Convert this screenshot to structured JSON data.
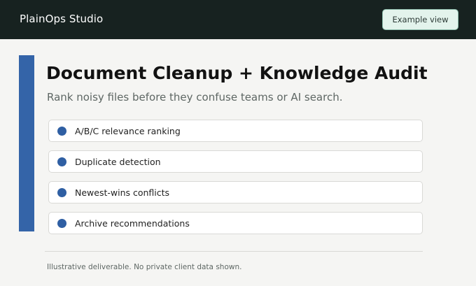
{
  "header": {
    "brand": "PlainOps Studio",
    "example_button_label": "Example view"
  },
  "main": {
    "title": "Document Cleanup + Knowledge Audit",
    "subtitle": "Rank noisy files before they confuse teams or AI search.",
    "features": [
      {
        "label": "A/B/C relevance ranking",
        "icon": "bullet-dot"
      },
      {
        "label": "Duplicate detection",
        "icon": "bullet-dot"
      },
      {
        "label": "Newest-wins conflicts",
        "icon": "bullet-dot"
      },
      {
        "label": "Archive recommendations",
        "icon": "bullet-dot"
      }
    ],
    "footnote": "Illustrative deliverable. No private client data shown."
  },
  "colors": {
    "topbar": "#172220",
    "accent": "#3464a8",
    "button_bg": "#e3f3ec",
    "button_border": "#8fbfae"
  }
}
